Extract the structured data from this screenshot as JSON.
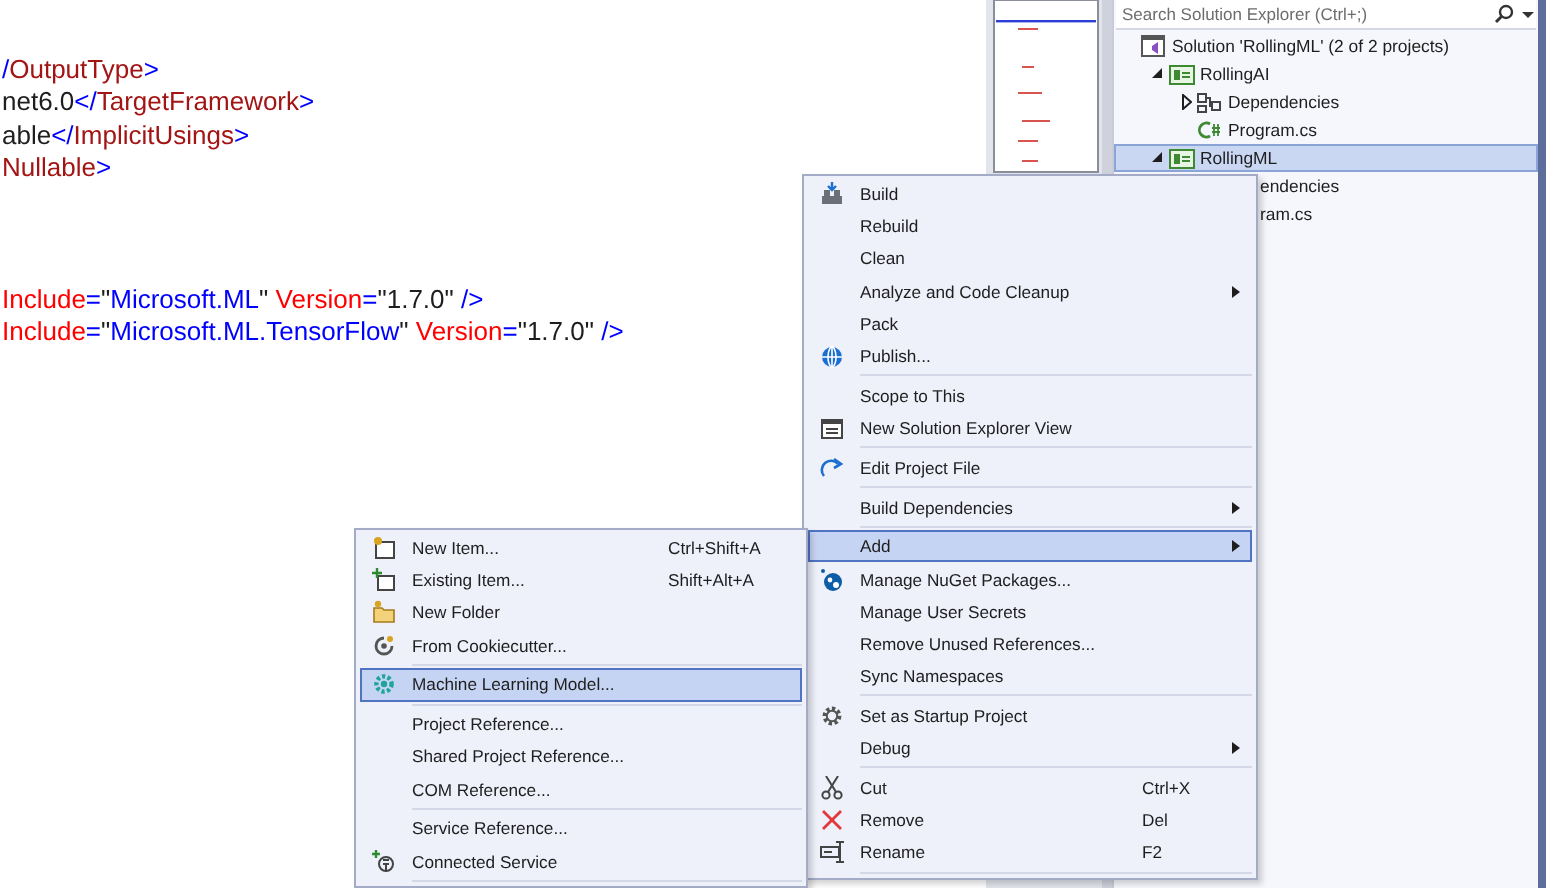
{
  "editor": {
    "lines": [
      {
        "tokens": [
          {
            "text": "/",
            "kind": "tag"
          },
          {
            "text": "OutputType",
            "kind": "element"
          },
          {
            "text": ">",
            "kind": "tag"
          }
        ]
      },
      {
        "tokens": [
          {
            "text": "net6.0",
            "kind": "text"
          },
          {
            "text": "</",
            "kind": "tag"
          },
          {
            "text": "TargetFramework",
            "kind": "element"
          },
          {
            "text": ">",
            "kind": "tag"
          }
        ]
      },
      {
        "tokens": [
          {
            "text": "able",
            "kind": "text"
          },
          {
            "text": "</",
            "kind": "tag"
          },
          {
            "text": "ImplicitUsings",
            "kind": "element"
          },
          {
            "text": ">",
            "kind": "tag"
          }
        ]
      },
      {
        "tokens": [
          {
            "text": "Nullable",
            "kind": "element"
          },
          {
            "text": ">",
            "kind": "tag"
          }
        ]
      },
      {
        "kind": "blank"
      },
      {
        "kind": "blank"
      },
      {
        "kind": "blank"
      },
      {
        "tokens": [
          {
            "text": "Include",
            "kind": "attribute"
          },
          {
            "text": "=",
            "kind": "tag"
          },
          {
            "text": "\"",
            "kind": "text"
          },
          {
            "text": "Microsoft.ML",
            "kind": "value"
          },
          {
            "text": "\" ",
            "kind": "text"
          },
          {
            "text": "Version",
            "kind": "attribute"
          },
          {
            "text": "=",
            "kind": "tag"
          },
          {
            "text": "\"1.7.0\" ",
            "kind": "text"
          },
          {
            "text": "/>",
            "kind": "tag"
          }
        ]
      },
      {
        "tokens": [
          {
            "text": "Include",
            "kind": "attribute"
          },
          {
            "text": "=",
            "kind": "tag"
          },
          {
            "text": "\"",
            "kind": "text"
          },
          {
            "text": "Microsoft.ML.TensorFlow",
            "kind": "value"
          },
          {
            "text": "\" ",
            "kind": "text"
          },
          {
            "text": "Version",
            "kind": "attribute"
          },
          {
            "text": "=",
            "kind": "tag"
          },
          {
            "text": "\"1.7.0\" ",
            "kind": "text"
          },
          {
            "text": "/>",
            "kind": "tag"
          }
        ]
      }
    ]
  },
  "solution_explorer": {
    "search": {
      "placeholder": "Search Solution Explorer (Ctrl+;)"
    },
    "tree": [
      {
        "kind": "solution",
        "text": "Solution 'RollingML' (2 of 2 projects)",
        "selected": false,
        "children": [
          {
            "kind": "project",
            "text": "RollingAI",
            "expanded": true,
            "selected": false,
            "children": [
              {
                "kind": "dependencies",
                "text": "Dependencies",
                "expanded": false,
                "selected": false
              },
              {
                "kind": "file",
                "text": "Program.cs",
                "selected": false
              }
            ]
          },
          {
            "kind": "project",
            "text": "RollingML",
            "expanded": true,
            "selected": true,
            "children": [
              {
                "text": "endencies",
                "covered": true,
                "selected": false
              },
              {
                "text": "ram.cs",
                "covered": true,
                "selected": false
              }
            ]
          }
        ]
      }
    ]
  },
  "context_menu": {
    "items": [
      {
        "kind": "command",
        "label": "Build",
        "selected": false
      },
      {
        "kind": "command",
        "label": "Rebuild",
        "selected": false
      },
      {
        "kind": "command",
        "label": "Clean",
        "selected": false
      },
      {
        "kind": "command",
        "label": "Analyze and Code Cleanup",
        "has_submenu": true,
        "selected": false
      },
      {
        "kind": "command",
        "label": "Pack",
        "selected": false
      },
      {
        "kind": "command",
        "label": "Publish...",
        "selected": false
      },
      {
        "kind": "separator"
      },
      {
        "kind": "command",
        "label": "Scope to This",
        "selected": false
      },
      {
        "kind": "command",
        "label": "New Solution Explorer View",
        "selected": false
      },
      {
        "kind": "separator"
      },
      {
        "kind": "command",
        "label": "Edit Project File",
        "selected": false
      },
      {
        "kind": "separator"
      },
      {
        "kind": "command",
        "label": "Build Dependencies",
        "has_submenu": true,
        "selected": false
      },
      {
        "kind": "separator"
      },
      {
        "kind": "command",
        "label": "Add",
        "has_submenu": true,
        "selected": true
      },
      {
        "kind": "command",
        "label": "Manage NuGet Packages...",
        "selected": false
      },
      {
        "kind": "command",
        "label": "Manage User Secrets",
        "selected": false
      },
      {
        "kind": "command",
        "label": "Remove Unused References...",
        "selected": false
      },
      {
        "kind": "command",
        "label": "Sync Namespaces",
        "selected": false
      },
      {
        "kind": "separator"
      },
      {
        "kind": "command",
        "label": "Set as Startup Project",
        "selected": false
      },
      {
        "kind": "command",
        "label": "Debug",
        "has_submenu": true,
        "selected": false
      },
      {
        "kind": "separator"
      },
      {
        "kind": "command",
        "label": "Cut",
        "shortcut": "Ctrl+X",
        "selected": false
      },
      {
        "kind": "command",
        "label": "Remove",
        "shortcut": "Del",
        "selected": false
      },
      {
        "kind": "command",
        "label": "Rename",
        "shortcut": "F2",
        "selected": false
      },
      {
        "kind": "separator"
      }
    ]
  },
  "add_submenu": {
    "items": [
      {
        "kind": "command",
        "label": "New Item...",
        "shortcut": "Ctrl+Shift+A",
        "selected": false
      },
      {
        "kind": "command",
        "label": "Existing Item...",
        "shortcut": "Shift+Alt+A",
        "selected": false
      },
      {
        "kind": "command",
        "label": "New Folder",
        "selected": false
      },
      {
        "kind": "command",
        "label": "From Cookiecutter...",
        "selected": false
      },
      {
        "kind": "separator"
      },
      {
        "kind": "command",
        "label": "Machine Learning Model...",
        "selected": true
      },
      {
        "kind": "separator"
      },
      {
        "kind": "command",
        "label": "Project Reference...",
        "selected": false
      },
      {
        "kind": "command",
        "label": "Shared Project Reference...",
        "selected": false
      },
      {
        "kind": "command",
        "label": "COM Reference...",
        "selected": false
      },
      {
        "kind": "separator"
      },
      {
        "kind": "command",
        "label": "Service Reference...",
        "selected": false
      },
      {
        "kind": "command",
        "label": "Connected Service",
        "selected": false
      },
      {
        "kind": "separator"
      }
    ]
  }
}
